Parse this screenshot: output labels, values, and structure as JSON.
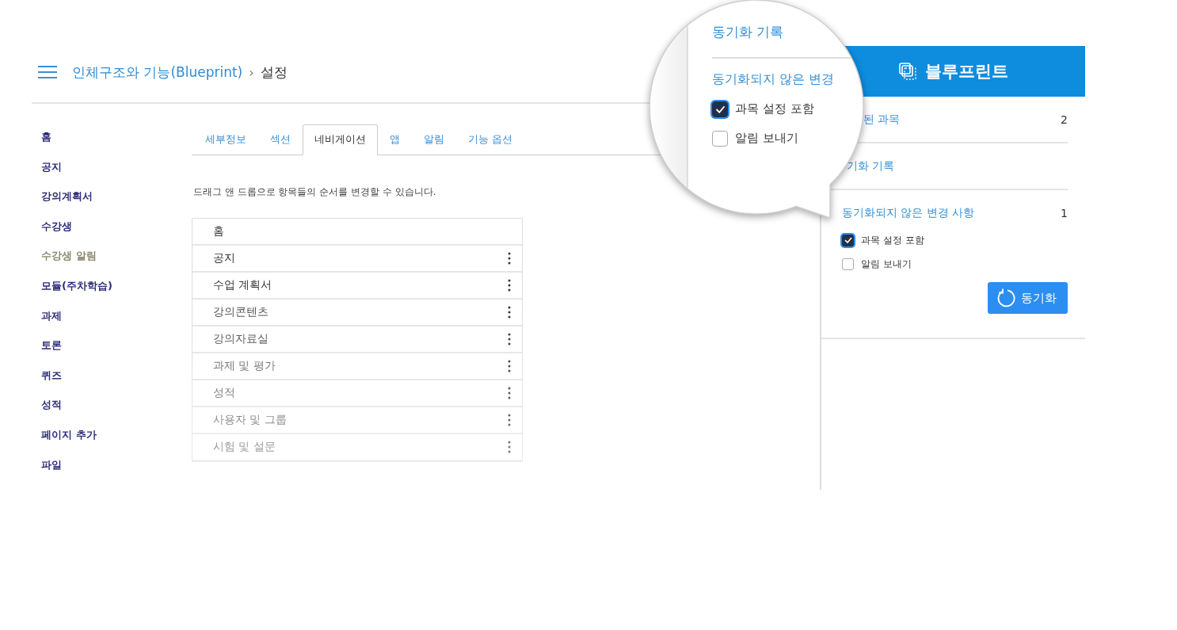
{
  "breadcrumb": {
    "course": "인체구조와 기능(Blueprint)",
    "separator": "›",
    "current": "설정"
  },
  "nav": [
    {
      "label": "홈",
      "dimmed": false
    },
    {
      "label": "공지",
      "dimmed": false
    },
    {
      "label": "강의계획서",
      "dimmed": false
    },
    {
      "label": "수강생",
      "dimmed": false
    },
    {
      "label": "수강생 알림",
      "dimmed": true
    },
    {
      "label": "모듈(주차학습)",
      "dimmed": false
    },
    {
      "label": "과제",
      "dimmed": false
    },
    {
      "label": "토론",
      "dimmed": false
    },
    {
      "label": "퀴즈",
      "dimmed": false
    },
    {
      "label": "성적",
      "dimmed": false
    },
    {
      "label": "페이지 추가",
      "dimmed": false
    },
    {
      "label": "파일",
      "dimmed": false
    }
  ],
  "tabs": [
    {
      "label": "세부정보",
      "selected": false
    },
    {
      "label": "섹션",
      "selected": false
    },
    {
      "label": "네비게이션",
      "selected": true
    },
    {
      "label": "앱",
      "selected": false
    },
    {
      "label": "알림",
      "selected": false
    },
    {
      "label": "기능 옵션",
      "selected": false
    }
  ],
  "instructions": "드래그 앤 드롭으로 항목들의 순서를 변경할 수 있습니다.",
  "nav_items": [
    {
      "label": "홈",
      "menu": false
    },
    {
      "label": "공지",
      "menu": true
    },
    {
      "label": "수업 계획서",
      "menu": true
    },
    {
      "label": "강의콘텐츠",
      "menu": true
    },
    {
      "label": "강의자료실",
      "menu": true
    },
    {
      "label": "과제 및 평가",
      "menu": true
    },
    {
      "label": "성적",
      "menu": true
    },
    {
      "label": "사용자 및 그룹",
      "menu": true
    },
    {
      "label": "시험 및 설문",
      "menu": true
    }
  ],
  "blueprint_panel": {
    "title": "블루프린트",
    "rows": [
      {
        "label": "된 과목",
        "count": "2"
      },
      {
        "label": "기화 기록"
      },
      {
        "label": "동기화되지 않은 변경 사항",
        "count": "1"
      }
    ],
    "options": [
      {
        "label": "과목 설정 포함",
        "checked": true
      },
      {
        "label": "알림 보내기",
        "checked": false
      }
    ],
    "sync_button": "동기화"
  },
  "magnifier": {
    "history_link": "동기화 기록",
    "unsynced_label": "동기화되지 않은 변경",
    "options": [
      {
        "label": "과목 설정 포함",
        "checked": true
      },
      {
        "label": "알림 보내기",
        "checked": false
      }
    ]
  }
}
